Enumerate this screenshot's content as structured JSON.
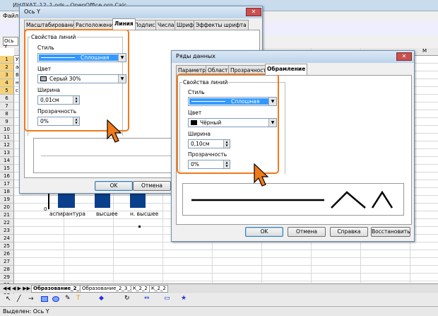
{
  "app": {
    "window_title": "ИНДУАТ_12_1.ods - OpenOffice.org Calc",
    "menu_first": "Файл",
    "namebox": "Ось Y",
    "status_text": "Выделен: Ось Y"
  },
  "sheet": {
    "rows": [
      "1",
      "2",
      "3",
      "4",
      "5",
      "6",
      "7",
      "8",
      "9",
      "10",
      "11",
      "12",
      "13",
      "14",
      "15",
      "16",
      "17",
      "18",
      "19",
      "20",
      "21",
      "22",
      "23",
      "24",
      "25",
      "26",
      "27",
      "28",
      "29",
      "30",
      "31",
      "32"
    ],
    "cell_fragments": [
      "Ур",
      "ас",
      "Вы",
      "н.",
      "с"
    ],
    "tabs": [
      "Образование_2_3",
      "Образование_2_3_2",
      "К_2_2",
      "К_2_2"
    ],
    "column_m": "M"
  },
  "chart": {
    "zero_label": "0",
    "categories": [
      "аспирантура",
      "высшее",
      "н. высшее"
    ]
  },
  "dialog_axis": {
    "title": "Ось Y",
    "tabs": [
      "Масштабирование",
      "Расположение",
      "Линия",
      "Подпись",
      "Числа",
      "Шрифт",
      "Эффекты шрифта"
    ],
    "active_tab": "Линия",
    "group_title": "Свойства линий",
    "style_label": "Стиль",
    "style_value": "Сплошная",
    "color_label": "Цвет",
    "color_value": "Серый 30%",
    "color_hex": "#b3b3b3",
    "width_label": "Ширина",
    "width_value": "0,01см",
    "transparency_label": "Прозрачность",
    "transparency_value": "0%",
    "ok_label": "OK",
    "cancel_label": "Отмена"
  },
  "dialog_series": {
    "title": "Ряды данных",
    "tabs": [
      "Параметры",
      "Область",
      "Прозрачность",
      "Обрамление"
    ],
    "active_tab": "Обрамление",
    "group_title": "Свойства линий",
    "style_label": "Стиль",
    "style_value": "Сплошная",
    "color_label": "Цвет",
    "color_value": "Чёрный",
    "color_hex": "#000000",
    "width_label": "Ширина",
    "width_value": "0,10см",
    "transparency_label": "Прозрачность",
    "transparency_value": "0%",
    "ok_label": "OK",
    "cancel_label": "Отмена",
    "help_label": "Справка",
    "reset_label": "Восстановить"
  },
  "colors": {
    "highlight": "#f07a1a",
    "selection": "#3399ff",
    "bar_blue": "#0a3f8c"
  }
}
